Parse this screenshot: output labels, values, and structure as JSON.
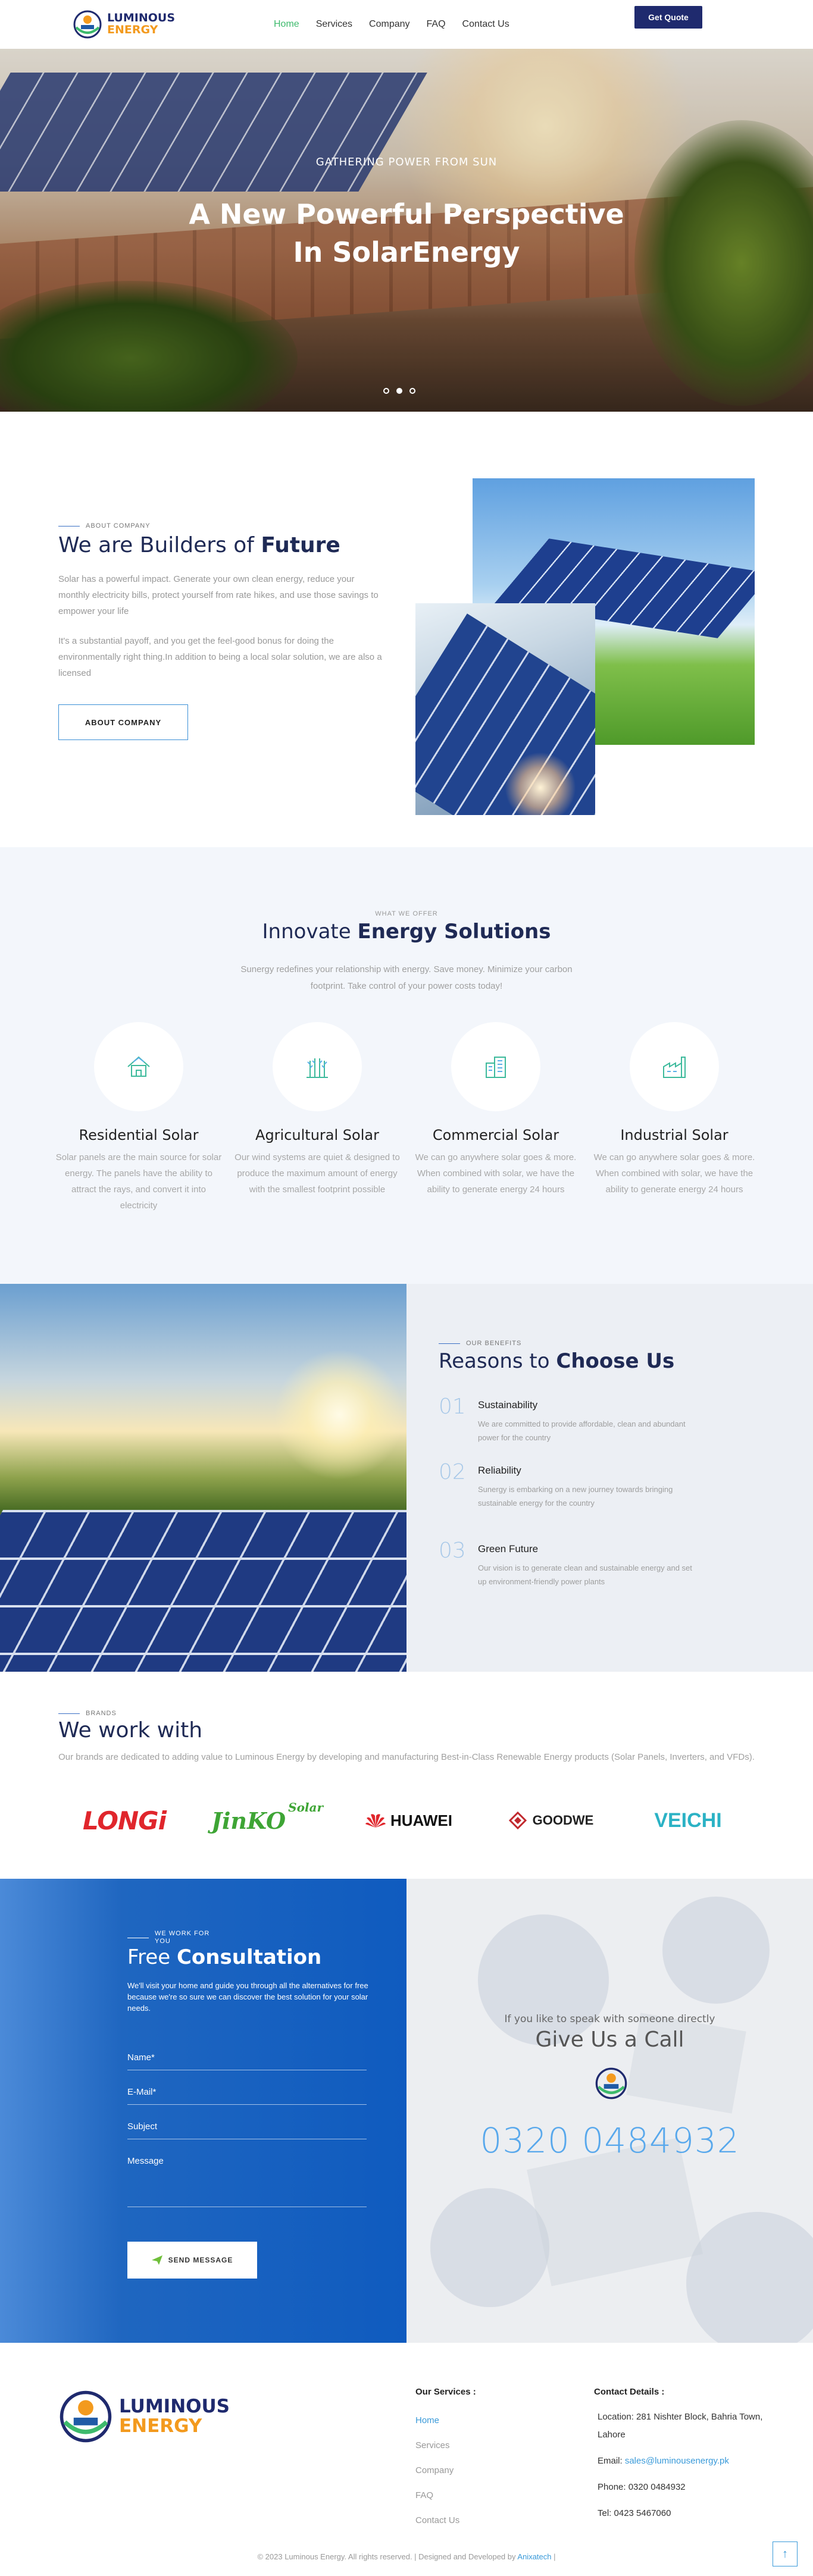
{
  "brand": {
    "line1": "LUMINOUS",
    "line2": "ENERGY"
  },
  "nav": {
    "items": [
      {
        "label": "Home",
        "active": true
      },
      {
        "label": "Services"
      },
      {
        "label": "Company"
      },
      {
        "label": "FAQ"
      },
      {
        "label": "Contact Us"
      }
    ],
    "quote_label": "Get Quote"
  },
  "hero": {
    "subtitle": "GATHERING POWER FROM SUN",
    "title_line1": "A New Powerful Perspective",
    "title_line2": "In SolarEnergy",
    "slides": 3,
    "active_slide": 2
  },
  "about": {
    "eyebrow": "ABOUT COMPANY",
    "title_prefix": "We are Builders of ",
    "title_bold": "Future",
    "p1": "Solar has a powerful impact. Generate your own clean energy, reduce your monthly electricity bills, protect yourself from rate hikes, and use those savings to empower your life",
    "p2": "It's a substantial payoff, and you get the feel-good bonus for doing the environmentally right thing.In addition to being a local solar solution, we are also a licensed",
    "button": "ABOUT COMPANY"
  },
  "services": {
    "eyebrow": "WHAT WE OFFER",
    "title_prefix": "Innovate ",
    "title_bold": "Energy Solutions",
    "intro": "Sunergy redefines your relationship with energy. Save money. Minimize your carbon footprint. Take control of your power costs today!",
    "items": [
      {
        "icon": "house-icon",
        "title": "Residential Solar",
        "text": "Solar panels are the main source for solar energy. The panels have the ability to attract the rays, and convert it into electricity"
      },
      {
        "icon": "crops-icon",
        "title": "Agricultural Solar",
        "text": "Our wind systems are quiet & designed to produce the maximum amount of energy with the smallest footprint possible"
      },
      {
        "icon": "building-icon",
        "title": "Commercial Solar",
        "text": "We can go anywhere solar goes & more. When combined with solar, we have the ability to generate energy 24 hours"
      },
      {
        "icon": "factory-icon",
        "title": "Industrial Solar",
        "text": "We can go anywhere solar goes & more. When combined with solar, we have the ability to generate energy 24 hours"
      }
    ]
  },
  "why": {
    "eyebrow": "OUR BENEFITS",
    "title_prefix": "Reasons to ",
    "title_bold": "Choose Us",
    "items": [
      {
        "num": "01",
        "title": "Sustainability",
        "text": "We are committed to provide affordable, clean and abundant power for the country"
      },
      {
        "num": "02",
        "title": "Reliability",
        "text": "Sunergy is embarking on a new journey towards bringing sustainable energy for the country"
      },
      {
        "num": "03",
        "title": "Green Future",
        "text": "Our vision is to generate clean and sustainable energy and set up environment-friendly power plants"
      }
    ]
  },
  "brands": {
    "eyebrow": "BRANDS",
    "title": "We work with",
    "desc": "Our brands are dedicated to adding value to Luminous Energy by developing and manufacturing Best-in-Class Renewable Energy products (Solar Panels, Inverters, and VFDs).",
    "logos": {
      "longi": "LONGi",
      "jinko": "JinKO",
      "jinko_tag": "Solar",
      "huawei": "HUAWEI",
      "goodwe": "GOODWE",
      "veichi": "VEICHI"
    }
  },
  "consult": {
    "eyebrow_line1": "WE WORK FOR",
    "eyebrow_line2": "YOU",
    "title_prefix": "Free ",
    "title_bold": "Consultation",
    "intro": "We'll visit your home and guide you through all the alternatives for free because we're so sure we can discover the best solution for your solar needs.",
    "fields": {
      "name": "Name*",
      "email": "E-Mail*",
      "subject": "Subject",
      "message": "Message"
    },
    "send": "SEND MESSAGE",
    "call_sub": "If you like to speak with someone directly",
    "call_title": "Give Us a Call",
    "phone": "0320 0484932"
  },
  "footer": {
    "services_title": "Our Services :",
    "services": [
      "Home",
      "Services",
      "Company",
      "FAQ",
      "Contact Us"
    ],
    "details_title": "Contact Details :",
    "location": "Location: 281 Nishter Block, Bahria Town, Lahore",
    "email_label": "Email: ",
    "email": "sales@luminousenergy.pk",
    "phone": "Phone: 0320 0484932",
    "tel": "Tel: 0423 5467060",
    "copyright": "© 2023 Luminous Energy. All rights reserved. | Designed and Developed by ",
    "developer": "Anixatech",
    "copyright_end": " |"
  },
  "colors": {
    "navy": "#1f2a6e",
    "orange": "#f39a1e",
    "green": "#3dba6c",
    "blue": "#0f5bbf",
    "phone_blue": "#58a8ec"
  }
}
